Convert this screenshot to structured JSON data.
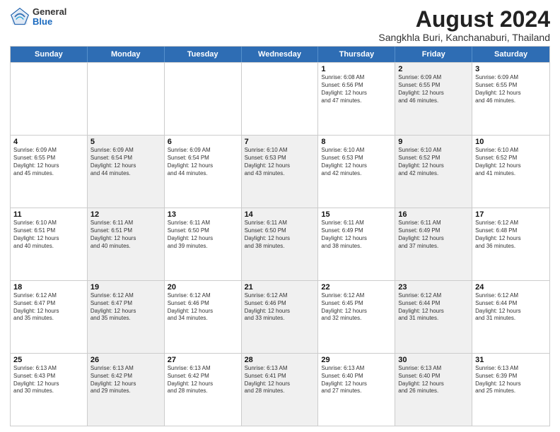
{
  "logo": {
    "general": "General",
    "blue": "Blue"
  },
  "title": "August 2024",
  "location": "Sangkhla Buri, Kanchanaburi, Thailand",
  "days": [
    "Sunday",
    "Monday",
    "Tuesday",
    "Wednesday",
    "Thursday",
    "Friday",
    "Saturday"
  ],
  "rows": [
    [
      {
        "day": "",
        "text": "",
        "shaded": false
      },
      {
        "day": "",
        "text": "",
        "shaded": false
      },
      {
        "day": "",
        "text": "",
        "shaded": false
      },
      {
        "day": "",
        "text": "",
        "shaded": false
      },
      {
        "day": "1",
        "text": "Sunrise: 6:08 AM\nSunset: 6:56 PM\nDaylight: 12 hours\nand 47 minutes.",
        "shaded": false
      },
      {
        "day": "2",
        "text": "Sunrise: 6:09 AM\nSunset: 6:55 PM\nDaylight: 12 hours\nand 46 minutes.",
        "shaded": true
      },
      {
        "day": "3",
        "text": "Sunrise: 6:09 AM\nSunset: 6:55 PM\nDaylight: 12 hours\nand 46 minutes.",
        "shaded": false
      }
    ],
    [
      {
        "day": "4",
        "text": "Sunrise: 6:09 AM\nSunset: 6:55 PM\nDaylight: 12 hours\nand 45 minutes.",
        "shaded": false
      },
      {
        "day": "5",
        "text": "Sunrise: 6:09 AM\nSunset: 6:54 PM\nDaylight: 12 hours\nand 44 minutes.",
        "shaded": true
      },
      {
        "day": "6",
        "text": "Sunrise: 6:09 AM\nSunset: 6:54 PM\nDaylight: 12 hours\nand 44 minutes.",
        "shaded": false
      },
      {
        "day": "7",
        "text": "Sunrise: 6:10 AM\nSunset: 6:53 PM\nDaylight: 12 hours\nand 43 minutes.",
        "shaded": true
      },
      {
        "day": "8",
        "text": "Sunrise: 6:10 AM\nSunset: 6:53 PM\nDaylight: 12 hours\nand 42 minutes.",
        "shaded": false
      },
      {
        "day": "9",
        "text": "Sunrise: 6:10 AM\nSunset: 6:52 PM\nDaylight: 12 hours\nand 42 minutes.",
        "shaded": true
      },
      {
        "day": "10",
        "text": "Sunrise: 6:10 AM\nSunset: 6:52 PM\nDaylight: 12 hours\nand 41 minutes.",
        "shaded": false
      }
    ],
    [
      {
        "day": "11",
        "text": "Sunrise: 6:10 AM\nSunset: 6:51 PM\nDaylight: 12 hours\nand 40 minutes.",
        "shaded": false
      },
      {
        "day": "12",
        "text": "Sunrise: 6:11 AM\nSunset: 6:51 PM\nDaylight: 12 hours\nand 40 minutes.",
        "shaded": true
      },
      {
        "day": "13",
        "text": "Sunrise: 6:11 AM\nSunset: 6:50 PM\nDaylight: 12 hours\nand 39 minutes.",
        "shaded": false
      },
      {
        "day": "14",
        "text": "Sunrise: 6:11 AM\nSunset: 6:50 PM\nDaylight: 12 hours\nand 38 minutes.",
        "shaded": true
      },
      {
        "day": "15",
        "text": "Sunrise: 6:11 AM\nSunset: 6:49 PM\nDaylight: 12 hours\nand 38 minutes.",
        "shaded": false
      },
      {
        "day": "16",
        "text": "Sunrise: 6:11 AM\nSunset: 6:49 PM\nDaylight: 12 hours\nand 37 minutes.",
        "shaded": true
      },
      {
        "day": "17",
        "text": "Sunrise: 6:12 AM\nSunset: 6:48 PM\nDaylight: 12 hours\nand 36 minutes.",
        "shaded": false
      }
    ],
    [
      {
        "day": "18",
        "text": "Sunrise: 6:12 AM\nSunset: 6:47 PM\nDaylight: 12 hours\nand 35 minutes.",
        "shaded": false
      },
      {
        "day": "19",
        "text": "Sunrise: 6:12 AM\nSunset: 6:47 PM\nDaylight: 12 hours\nand 35 minutes.",
        "shaded": true
      },
      {
        "day": "20",
        "text": "Sunrise: 6:12 AM\nSunset: 6:46 PM\nDaylight: 12 hours\nand 34 minutes.",
        "shaded": false
      },
      {
        "day": "21",
        "text": "Sunrise: 6:12 AM\nSunset: 6:46 PM\nDaylight: 12 hours\nand 33 minutes.",
        "shaded": true
      },
      {
        "day": "22",
        "text": "Sunrise: 6:12 AM\nSunset: 6:45 PM\nDaylight: 12 hours\nand 32 minutes.",
        "shaded": false
      },
      {
        "day": "23",
        "text": "Sunrise: 6:12 AM\nSunset: 6:44 PM\nDaylight: 12 hours\nand 31 minutes.",
        "shaded": true
      },
      {
        "day": "24",
        "text": "Sunrise: 6:12 AM\nSunset: 6:44 PM\nDaylight: 12 hours\nand 31 minutes.",
        "shaded": false
      }
    ],
    [
      {
        "day": "25",
        "text": "Sunrise: 6:13 AM\nSunset: 6:43 PM\nDaylight: 12 hours\nand 30 minutes.",
        "shaded": false
      },
      {
        "day": "26",
        "text": "Sunrise: 6:13 AM\nSunset: 6:42 PM\nDaylight: 12 hours\nand 29 minutes.",
        "shaded": true
      },
      {
        "day": "27",
        "text": "Sunrise: 6:13 AM\nSunset: 6:42 PM\nDaylight: 12 hours\nand 28 minutes.",
        "shaded": false
      },
      {
        "day": "28",
        "text": "Sunrise: 6:13 AM\nSunset: 6:41 PM\nDaylight: 12 hours\nand 28 minutes.",
        "shaded": true
      },
      {
        "day": "29",
        "text": "Sunrise: 6:13 AM\nSunset: 6:40 PM\nDaylight: 12 hours\nand 27 minutes.",
        "shaded": false
      },
      {
        "day": "30",
        "text": "Sunrise: 6:13 AM\nSunset: 6:40 PM\nDaylight: 12 hours\nand 26 minutes.",
        "shaded": true
      },
      {
        "day": "31",
        "text": "Sunrise: 6:13 AM\nSunset: 6:39 PM\nDaylight: 12 hours\nand 25 minutes.",
        "shaded": false
      }
    ]
  ]
}
